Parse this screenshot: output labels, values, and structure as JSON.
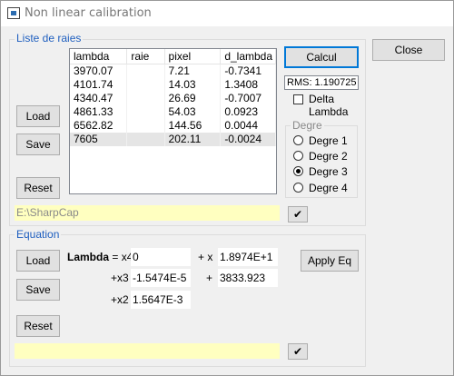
{
  "window": {
    "title": "Non linear calibration",
    "close_label": "Close"
  },
  "list_group": {
    "title": "Liste de raies",
    "columns": [
      "lambda",
      "raie",
      "pixel",
      "d_lambda"
    ],
    "rows": [
      {
        "lambda": "3970.07",
        "raie": "",
        "pixel": "7.21",
        "d_lambda": "-0.7341"
      },
      {
        "lambda": "4101.74",
        "raie": "",
        "pixel": "14.03",
        "d_lambda": "1.3408"
      },
      {
        "lambda": "4340.47",
        "raie": "",
        "pixel": "26.69",
        "d_lambda": "-0.7007"
      },
      {
        "lambda": "4861.33",
        "raie": "",
        "pixel": "54.03",
        "d_lambda": "0.0923"
      },
      {
        "lambda": "6562.82",
        "raie": "",
        "pixel": "144.56",
        "d_lambda": "0.0044"
      },
      {
        "lambda": "7605",
        "raie": "",
        "pixel": "202.11",
        "d_lambda": "-0.0024"
      }
    ],
    "selected_row_index": 5,
    "load_label": "Load",
    "save_label": "Save",
    "reset_label": "Reset",
    "calcul_label": "Calcul",
    "rms_text": "RMS:  1.190725",
    "delta_lambda_label_line1": "Delta",
    "delta_lambda_label_line2": "Lambda",
    "delta_lambda_checked": false,
    "file_path": "E:\\SharpCap",
    "check_icon": "checkmark-icon"
  },
  "degre_group": {
    "title": "Degre",
    "options": [
      "Degre 1",
      "Degre 2",
      "Degre 3",
      "Degre 4"
    ],
    "selected": "Degre 3"
  },
  "equation_group": {
    "title": "Equation",
    "load_label": "Load",
    "save_label": "Save",
    "reset_label": "Reset",
    "apply_label": "Apply Eq",
    "lambda_label": "Lambda",
    "x4_label": " = x4",
    "x_label": "+ x",
    "x3_label": "+x3",
    "plus_label": "+",
    "x2_label": "+x2",
    "coef_x4": "0",
    "coef_x": "1.8974E+1",
    "coef_x3": "-1.5474E-5",
    "coef_const": "3833.923",
    "coef_x2": "1.5647E-3",
    "status_text": "",
    "check_icon": "checkmark-icon"
  },
  "colors": {
    "group_title": "#1f5fbf",
    "yellow_field": "#ffffc0",
    "default_button_border": "#0078d7"
  }
}
